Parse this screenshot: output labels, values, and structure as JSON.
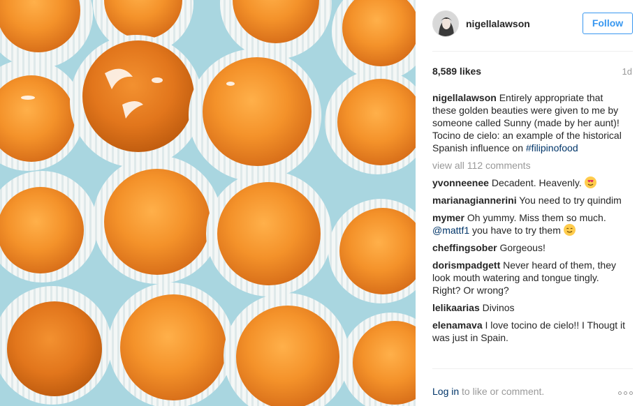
{
  "post": {
    "username": "nigellalawson",
    "follow_label": "Follow",
    "likes": "8,589 likes",
    "time": "1d",
    "caption": {
      "user": "nigellalawson",
      "text": "Entirely appropriate that these golden beauties were given to me by someone called Sunny (made by her aunt)! Tocino de cielo: an example of the historical Spanish influence on",
      "hashtag": "#filipinofood"
    },
    "view_all": "view all 112 comments",
    "comments": [
      {
        "user": "yvonneenee",
        "text": "Decadent. Heavenly.",
        "emoji": "heart-eyes"
      },
      {
        "user": "marianagiannerini",
        "text": "You need to try quindim"
      },
      {
        "user": "mymer",
        "text": "Oh yummy. Miss them so much.",
        "mention": "@mattf1",
        "after": "you have to try them",
        "emoji": "smile"
      },
      {
        "user": "cheffingsober",
        "text": "Gorgeous!"
      },
      {
        "user": "dorismpadgett",
        "text": "Never heard of them, they look mouth watering and tongue tingly. Right? Or wrong?"
      },
      {
        "user": "lelikaarias",
        "text": "Divinos"
      },
      {
        "user": "elenamava",
        "text": "I love tocino de cielo!! I Thougt it was just in Spain."
      }
    ],
    "login_label": "Log in",
    "login_suffix": "to like or comment."
  },
  "colors": {
    "accent": "#3897f0",
    "link": "#003569",
    "muted": "#999999",
    "dessert": "#f09a3a",
    "liner": "#b9dfe6"
  }
}
